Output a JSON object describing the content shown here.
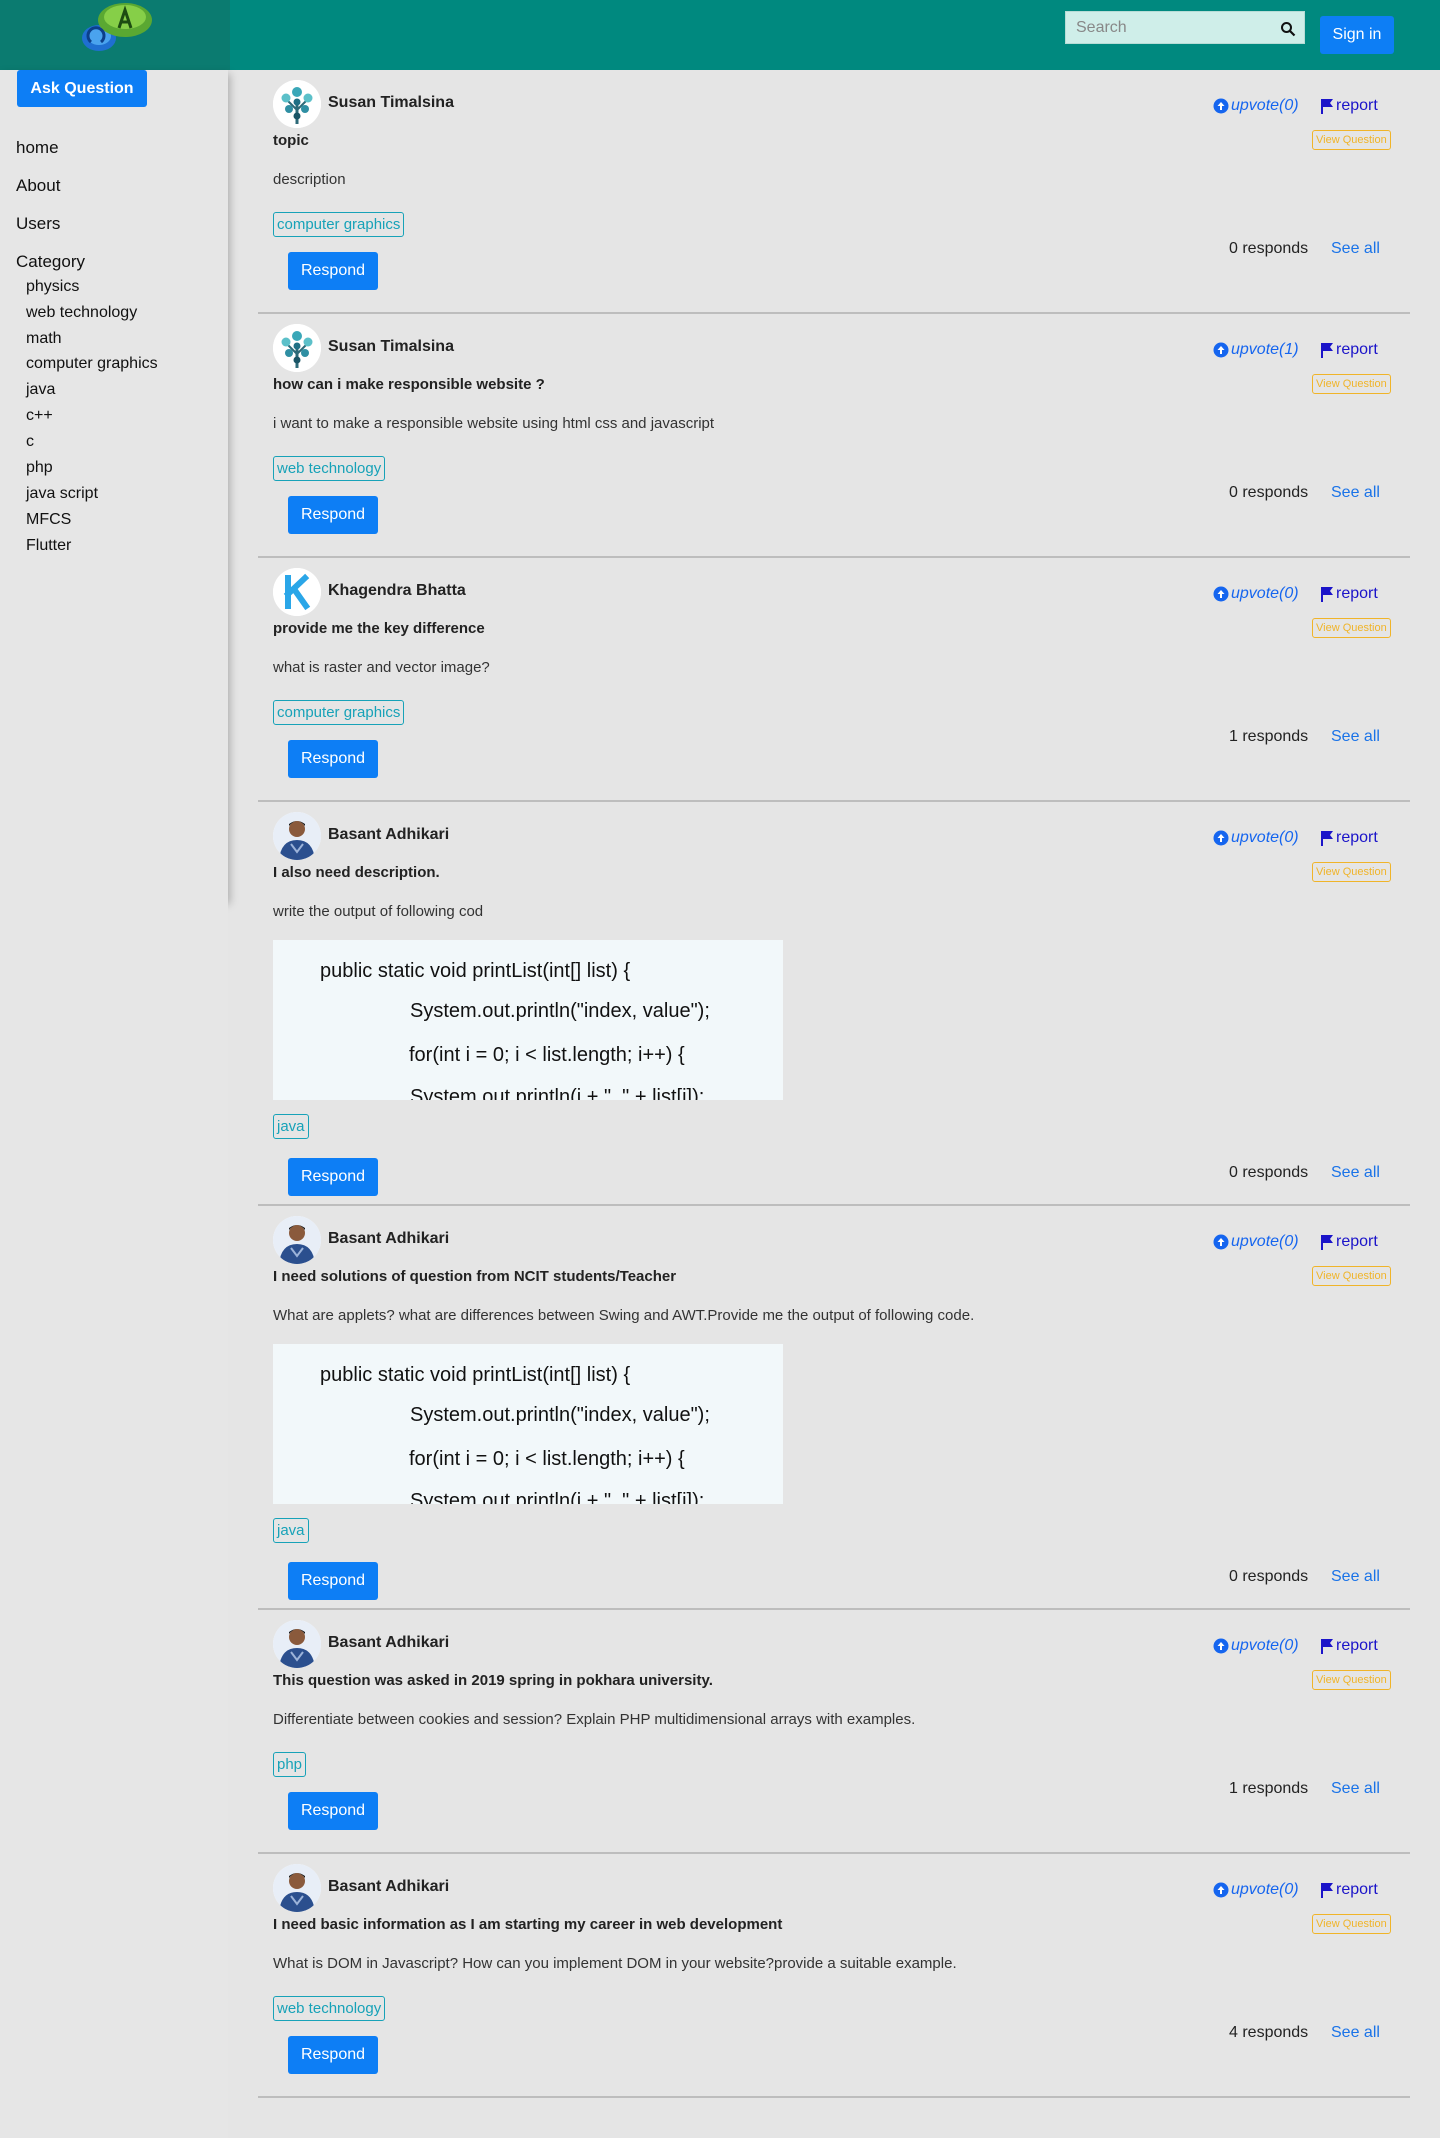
{
  "header": {
    "search_placeholder": "Search",
    "signin_label": "Sign in"
  },
  "sidebar": {
    "ask_label": "Ask Question",
    "nav": [
      "home",
      "About",
      "Users",
      "Category"
    ],
    "categories": [
      "physics",
      "web technology",
      "math",
      "computer graphics",
      "java",
      "c++",
      "c",
      "php",
      "java script",
      "MFCS",
      "Flutter"
    ]
  },
  "colors": {
    "topbar": "#00897f",
    "primary": "#0d7ef5",
    "tag": "#17a2b8",
    "view_question": "#f0b429"
  },
  "code_image_lines": [
    "public static void printList(int[] list) {",
    "System.out.println(\"index, value\");",
    "for(int i = 0; i < list.length; i++) {",
    "System.out.println(i + \", \" + list[i]);"
  ],
  "labels": {
    "report": "report",
    "view_question": "View Question",
    "respond": "Respond",
    "see_all": "See all"
  },
  "questions": [
    {
      "author": "Susan Timalsina",
      "avatar": "tree",
      "upvote": "upvote(0)",
      "title": "topic",
      "description": "description",
      "tag": "computer graphics",
      "responds": "0 responds",
      "has_code": false
    },
    {
      "author": "Susan Timalsina",
      "avatar": "tree",
      "upvote": "upvote(1)",
      "title": "how can i make responsible website ?",
      "description": "i want to make a responsible website using html css and javascript",
      "tag": "web technology",
      "responds": "0 responds",
      "has_code": false
    },
    {
      "author": "Khagendra Bhatta",
      "avatar": "letter-k",
      "upvote": "upvote(0)",
      "title": "provide me the key difference",
      "description": "what is raster and vector image?",
      "tag": "computer graphics",
      "responds": "1 responds",
      "has_code": false
    },
    {
      "author": "Basant Adhikari",
      "avatar": "person",
      "upvote": "upvote(0)",
      "title": "I also need description.",
      "description": "write the output of following cod",
      "tag": "java",
      "responds": "0 responds",
      "has_code": true
    },
    {
      "author": "Basant Adhikari",
      "avatar": "person",
      "upvote": "upvote(0)",
      "title": "I need solutions of question from NCIT students/Teacher",
      "description": "What are applets? what are differences between Swing and AWT.Provide me the output of following code.",
      "tag": "java",
      "responds": "0 responds",
      "has_code": true
    },
    {
      "author": "Basant Adhikari",
      "avatar": "person",
      "upvote": "upvote(0)",
      "title": "This question was asked in 2019 spring in pokhara university.",
      "description": "Differentiate between cookies and session? Explain PHP multidimensional arrays with examples.",
      "tag": "php",
      "responds": "1 responds",
      "has_code": false
    },
    {
      "author": "Basant Adhikari",
      "avatar": "person",
      "upvote": "upvote(0)",
      "title": "I need basic information as I am starting my career in web development",
      "description": "What is DOM in Javascript? How can you implement DOM in your website?provide a suitable example.",
      "tag": "web technology",
      "responds": "4 responds",
      "has_code": false
    }
  ]
}
